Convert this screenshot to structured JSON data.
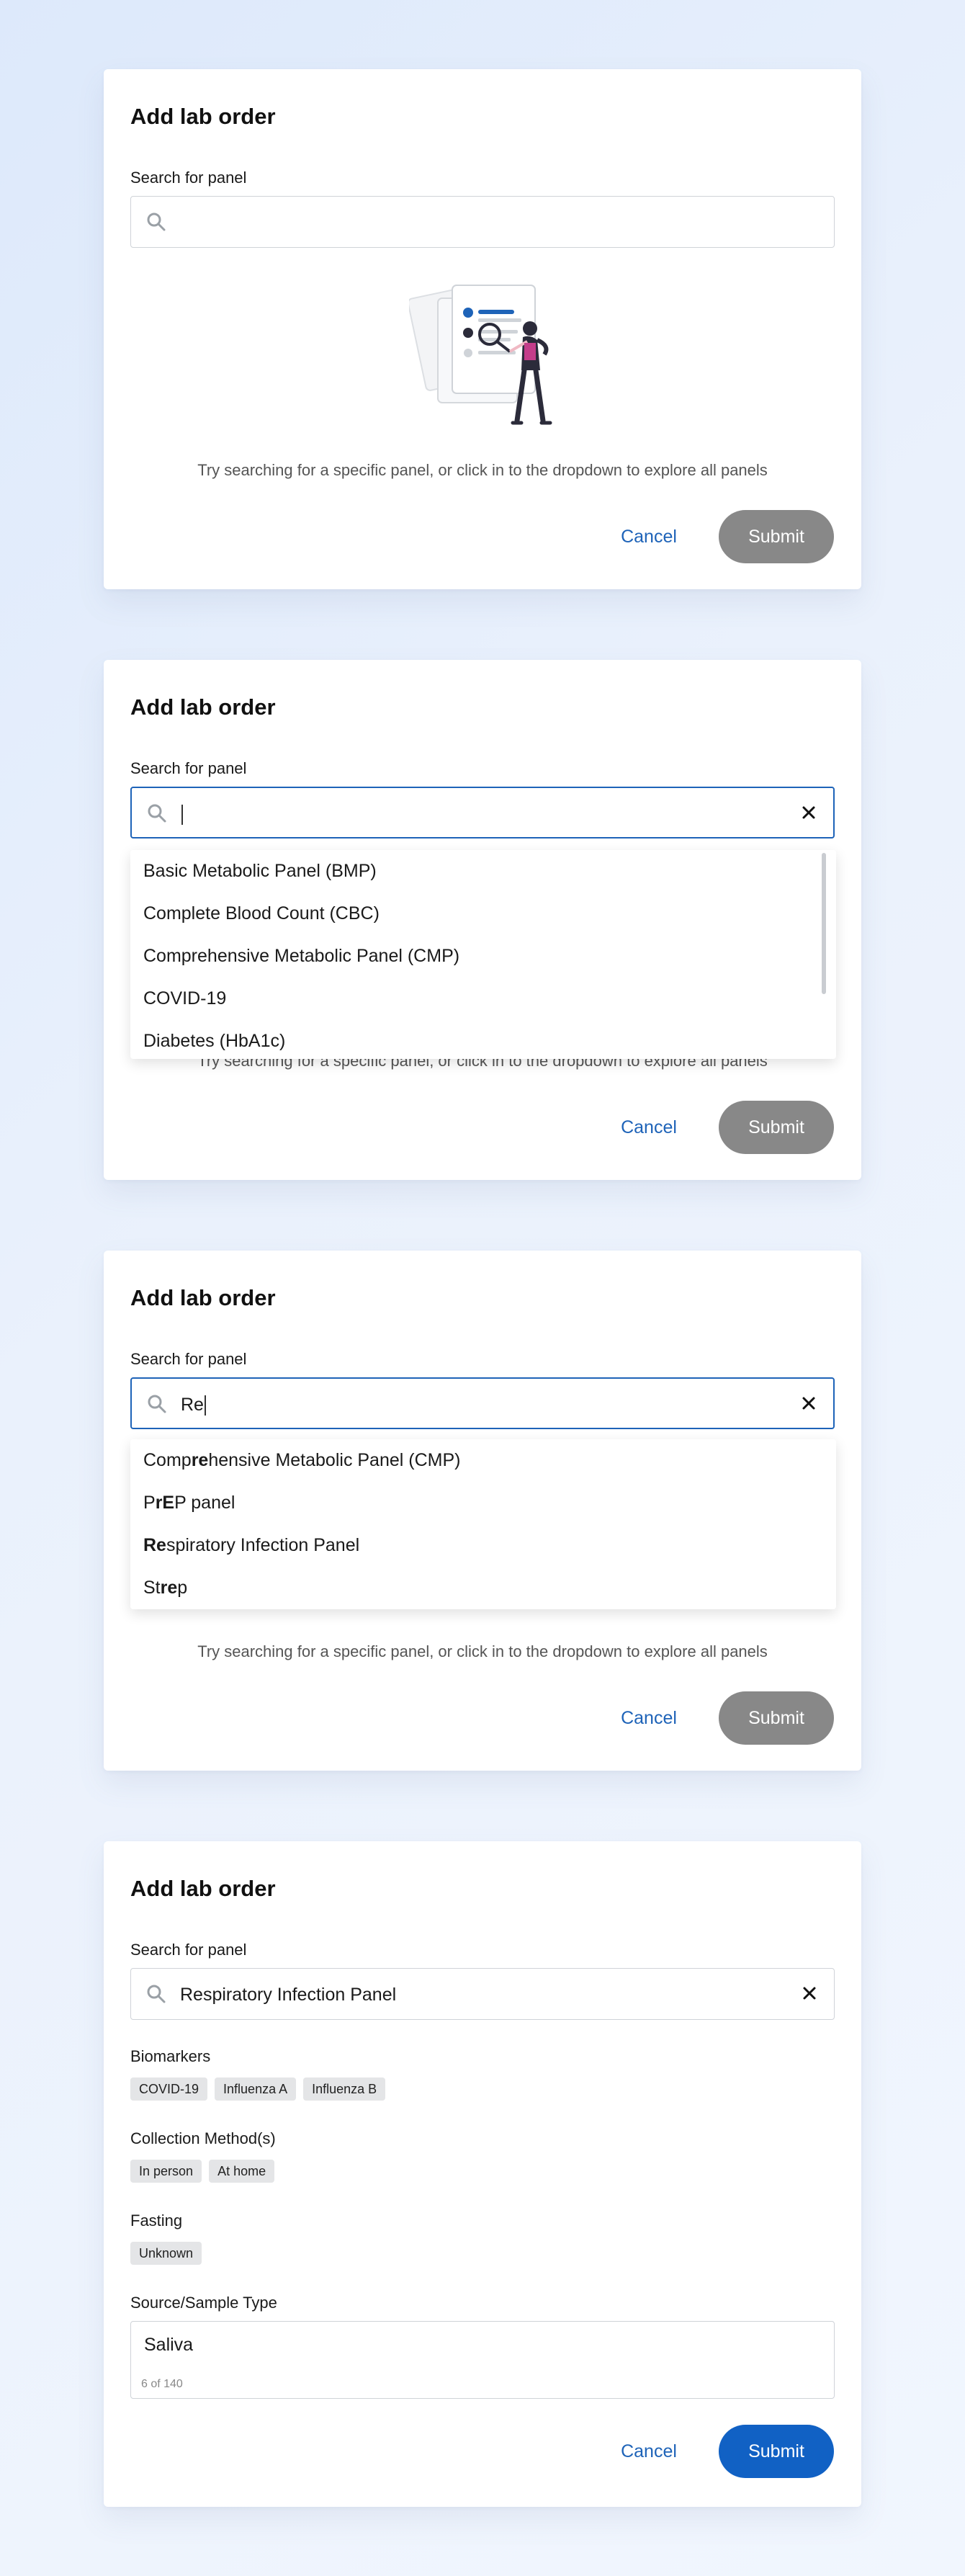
{
  "colors": {
    "primary": "#1161c4",
    "submit_disabled": "#888888",
    "link": "#1e63b8"
  },
  "common": {
    "title": "Add lab order",
    "search_label": "Search for panel",
    "hint": "Try searching for a specific panel, or click in to the dropdown to explore all panels",
    "cancel": "Cancel",
    "submit": "Submit"
  },
  "state2": {
    "search_value": "",
    "options": [
      "Basic Metabolic Panel (BMP)",
      "Complete Blood Count (CBC)",
      "Comprehensive Metabolic Panel (CMP)",
      "COVID-19",
      "Diabetes (HbA1c)"
    ]
  },
  "state3": {
    "search_value": "Re",
    "options": [
      {
        "pre": "Comp",
        "match": "re",
        "post": "hensive Metabolic Panel (CMP)"
      },
      {
        "pre": "P",
        "match": "rE",
        "post": "P panel"
      },
      {
        "pre": "",
        "match": "Re",
        "post": "spiratory Infection Panel"
      },
      {
        "pre": "St",
        "match": "re",
        "post": "p"
      }
    ]
  },
  "state4": {
    "search_value": "Respiratory Infection Panel",
    "biomarkers_label": "Biomarkers",
    "biomarkers": [
      "COVID-19",
      "Influenza A",
      "Influenza B"
    ],
    "collection_label": "Collection Method(s)",
    "collection": [
      "In person",
      "At home"
    ],
    "fasting_label": "Fasting",
    "fasting": [
      "Unknown"
    ],
    "sample_label": "Source/Sample Type",
    "sample_value": "Saliva",
    "sample_count": "6 of 140"
  }
}
